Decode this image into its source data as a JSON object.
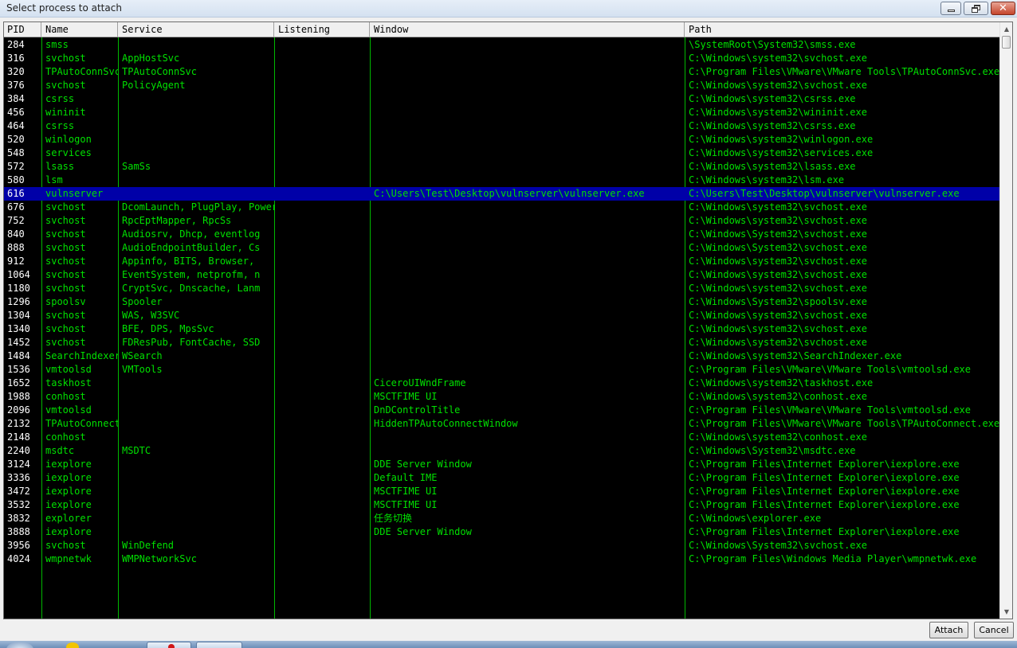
{
  "window": {
    "title": "Select process to attach"
  },
  "columns": {
    "pid": "PID",
    "name": "Name",
    "service": "Service",
    "listening": "Listening",
    "window": "Window",
    "path": "Path"
  },
  "rows": [
    {
      "pid": "284",
      "name": "smss",
      "service": "",
      "listening": "",
      "window": "",
      "path": "\\SystemRoot\\System32\\smss.exe"
    },
    {
      "pid": "316",
      "name": "svchost",
      "service": "AppHostSvc",
      "listening": "",
      "window": "",
      "path": "C:\\Windows\\system32\\svchost.exe"
    },
    {
      "pid": "320",
      "name": "TPAutoConnSvc",
      "service": "TPAutoConnSvc",
      "listening": "",
      "window": "",
      "path": "C:\\Program Files\\VMware\\VMware Tools\\TPAutoConnSvc.exe"
    },
    {
      "pid": "376",
      "name": "svchost",
      "service": "PolicyAgent",
      "listening": "",
      "window": "",
      "path": "C:\\Windows\\system32\\svchost.exe"
    },
    {
      "pid": "384",
      "name": "csrss",
      "service": "",
      "listening": "",
      "window": "",
      "path": "C:\\Windows\\system32\\csrss.exe"
    },
    {
      "pid": "456",
      "name": "wininit",
      "service": "",
      "listening": "",
      "window": "",
      "path": "C:\\Windows\\system32\\wininit.exe"
    },
    {
      "pid": "464",
      "name": "csrss",
      "service": "",
      "listening": "",
      "window": "",
      "path": "C:\\Windows\\system32\\csrss.exe"
    },
    {
      "pid": "520",
      "name": "winlogon",
      "service": "",
      "listening": "",
      "window": "",
      "path": "C:\\Windows\\system32\\winlogon.exe"
    },
    {
      "pid": "548",
      "name": "services",
      "service": "",
      "listening": "",
      "window": "",
      "path": "C:\\Windows\\system32\\services.exe"
    },
    {
      "pid": "572",
      "name": "lsass",
      "service": "SamSs",
      "listening": "",
      "window": "",
      "path": "C:\\Windows\\system32\\lsass.exe"
    },
    {
      "pid": "580",
      "name": "lsm",
      "service": "",
      "listening": "",
      "window": "",
      "path": "C:\\Windows\\system32\\lsm.exe"
    },
    {
      "pid": "616",
      "name": "vulnserver",
      "service": "",
      "listening": "",
      "window": "C:\\Users\\Test\\Desktop\\vulnserver\\vulnserver.exe",
      "path": "C:\\Users\\Test\\Desktop\\vulnserver\\vulnserver.exe",
      "selected": true
    },
    {
      "pid": "676",
      "name": "svchost",
      "service": "DcomLaunch, PlugPlay, Power",
      "listening": "",
      "window": "",
      "path": "C:\\Windows\\system32\\svchost.exe"
    },
    {
      "pid": "752",
      "name": "svchost",
      "service": "RpcEptMapper, RpcSs",
      "listening": "",
      "window": "",
      "path": "C:\\Windows\\system32\\svchost.exe"
    },
    {
      "pid": "840",
      "name": "svchost",
      "service": "Audiosrv, Dhcp, eventlog",
      "listening": "",
      "window": "",
      "path": "C:\\Windows\\System32\\svchost.exe"
    },
    {
      "pid": "888",
      "name": "svchost",
      "service": "AudioEndpointBuilder, Cs",
      "listening": "",
      "window": "",
      "path": "C:\\Windows\\System32\\svchost.exe"
    },
    {
      "pid": "912",
      "name": "svchost",
      "service": "Appinfo, BITS, Browser,",
      "listening": "",
      "window": "",
      "path": "C:\\Windows\\system32\\svchost.exe"
    },
    {
      "pid": "1064",
      "name": "svchost",
      "service": "EventSystem, netprofm, n",
      "listening": "",
      "window": "",
      "path": "C:\\Windows\\system32\\svchost.exe"
    },
    {
      "pid": "1180",
      "name": "svchost",
      "service": "CryptSvc, Dnscache, Lanm",
      "listening": "",
      "window": "",
      "path": "C:\\Windows\\system32\\svchost.exe"
    },
    {
      "pid": "1296",
      "name": "spoolsv",
      "service": "Spooler",
      "listening": "",
      "window": "",
      "path": "C:\\Windows\\System32\\spoolsv.exe"
    },
    {
      "pid": "1304",
      "name": "svchost",
      "service": "WAS, W3SVC",
      "listening": "",
      "window": "",
      "path": "C:\\Windows\\system32\\svchost.exe"
    },
    {
      "pid": "1340",
      "name": "svchost",
      "service": "BFE, DPS, MpsSvc",
      "listening": "",
      "window": "",
      "path": "C:\\Windows\\system32\\svchost.exe"
    },
    {
      "pid": "1452",
      "name": "svchost",
      "service": "FDResPub, FontCache, SSD",
      "listening": "",
      "window": "",
      "path": "C:\\Windows\\system32\\svchost.exe"
    },
    {
      "pid": "1484",
      "name": "SearchIndexer",
      "service": "WSearch",
      "listening": "",
      "window": "",
      "path": "C:\\Windows\\system32\\SearchIndexer.exe"
    },
    {
      "pid": "1536",
      "name": "vmtoolsd",
      "service": "VMTools",
      "listening": "",
      "window": "",
      "path": "C:\\Program Files\\VMware\\VMware Tools\\vmtoolsd.exe"
    },
    {
      "pid": "1652",
      "name": "taskhost",
      "service": "",
      "listening": "",
      "window": "CiceroUIWndFrame",
      "path": "C:\\Windows\\system32\\taskhost.exe"
    },
    {
      "pid": "1988",
      "name": "conhost",
      "service": "",
      "listening": "",
      "window": "MSCTFIME UI",
      "path": "C:\\Windows\\system32\\conhost.exe"
    },
    {
      "pid": "2096",
      "name": "vmtoolsd",
      "service": "",
      "listening": "",
      "window": "DnDControlTitle",
      "path": "C:\\Program Files\\VMware\\VMware Tools\\vmtoolsd.exe"
    },
    {
      "pid": "2132",
      "name": "TPAutoConnect",
      "service": "",
      "listening": "",
      "window": "HiddenTPAutoConnectWindow",
      "path": "C:\\Program Files\\VMware\\VMware Tools\\TPAutoConnect.exe"
    },
    {
      "pid": "2148",
      "name": "conhost",
      "service": "",
      "listening": "",
      "window": "",
      "path": "C:\\Windows\\system32\\conhost.exe"
    },
    {
      "pid": "2240",
      "name": "msdtc",
      "service": "MSDTC",
      "listening": "",
      "window": "",
      "path": "C:\\Windows\\System32\\msdtc.exe"
    },
    {
      "pid": "3124",
      "name": "iexplore",
      "service": "",
      "listening": "",
      "window": "DDE Server Window",
      "path": "C:\\Program Files\\Internet Explorer\\iexplore.exe"
    },
    {
      "pid": "3336",
      "name": "iexplore",
      "service": "",
      "listening": "",
      "window": "Default IME",
      "path": "C:\\Program Files\\Internet Explorer\\iexplore.exe"
    },
    {
      "pid": "3472",
      "name": "iexplore",
      "service": "",
      "listening": "",
      "window": "MSCTFIME UI",
      "path": "C:\\Program Files\\Internet Explorer\\iexplore.exe"
    },
    {
      "pid": "3532",
      "name": "iexplore",
      "service": "",
      "listening": "",
      "window": "MSCTFIME UI",
      "path": "C:\\Program Files\\Internet Explorer\\iexplore.exe"
    },
    {
      "pid": "3832",
      "name": "explorer",
      "service": "",
      "listening": "",
      "window": "任务切换",
      "path": "C:\\Windows\\explorer.exe"
    },
    {
      "pid": "3888",
      "name": "iexplore",
      "service": "",
      "listening": "",
      "window": "DDE Server Window",
      "path": "C:\\Program Files\\Internet Explorer\\iexplore.exe"
    },
    {
      "pid": "3956",
      "name": "svchost",
      "service": "WinDefend",
      "listening": "",
      "window": "",
      "path": "C:\\Windows\\System32\\svchost.exe"
    },
    {
      "pid": "4024",
      "name": "wmpnetwk",
      "service": "WMPNetworkSvc",
      "listening": "",
      "window": "",
      "path": "C:\\Program Files\\Windows Media Player\\wmpnetwk.exe"
    }
  ],
  "buttons": {
    "attach": "Attach",
    "cancel": "Cancel"
  },
  "colors": {
    "list_background": "#000000",
    "list_text": "#00e000",
    "pid_text": "#ffffff",
    "grid_lines": "#00b800",
    "selection": "#0000a8"
  },
  "icons": {
    "minimize": "minimize-icon",
    "maximize": "restore-icon",
    "close": "close-icon"
  }
}
